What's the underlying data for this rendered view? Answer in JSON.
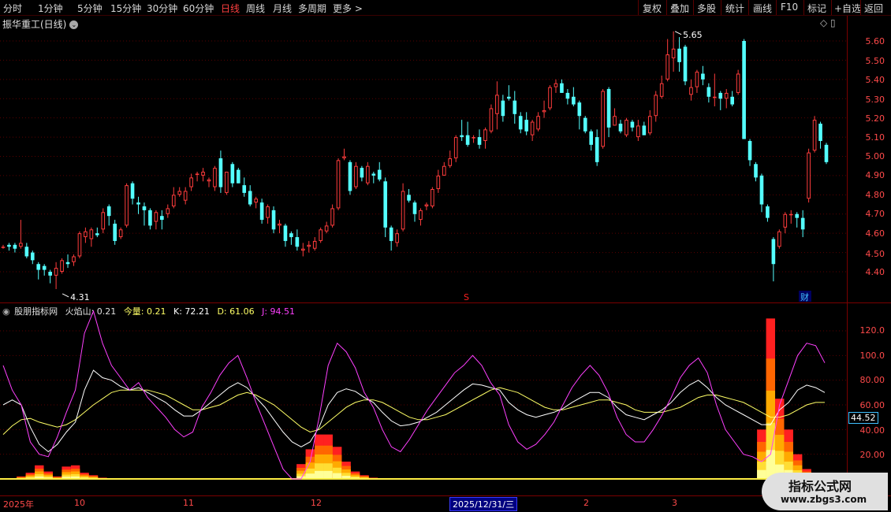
{
  "toolbar": {
    "periods": [
      "分时",
      "1分钟",
      "5分钟",
      "15分钟",
      "30分钟",
      "60分钟",
      "日线",
      "周线",
      "月线",
      "多周期",
      "更多 >"
    ],
    "active": "日线",
    "actions": [
      "复权",
      "叠加",
      "多股",
      "统计",
      "画线",
      "F10",
      "标记",
      "+自选",
      "返回"
    ]
  },
  "stock": {
    "title": "振华重工(日线)",
    "icon": "chevron-down-icon"
  },
  "top_icons": "◇ ▯",
  "price_axis": [
    "5.60",
    "5.50",
    "5.40",
    "5.30",
    "5.20",
    "5.10",
    "5.00",
    "4.90",
    "4.80",
    "4.70",
    "4.60",
    "4.50",
    "4.40"
  ],
  "price_marks": {
    "high": "5.65",
    "low": "4.31",
    "s_mark": "S",
    "cai_badge": "财"
  },
  "indicator": {
    "name": "股朋指标网",
    "huoyanshan": "火焰山: 0.21",
    "jinliang": "今量: 0.21",
    "k": "K: 72.21",
    "d": "D: 61.06",
    "j": "J: 94.51"
  },
  "ind_axis": [
    "120.0",
    "100.0",
    "80.00",
    "60.00",
    "40.00",
    "20.00"
  ],
  "cursor_value": "44.52",
  "date_axis": [
    "2025年",
    "10",
    "11",
    "12",
    "2",
    "3"
  ],
  "selected_date": "2025/12/31/三",
  "watermark": {
    "line1": "指标公式网",
    "line2": "www.zbgs3.com"
  },
  "colors": {
    "up": "#ff3c3c",
    "down": "#54ffff",
    "k_line": "#ffffff",
    "d_line": "#ffff66",
    "j_line": "#ff40ff"
  },
  "chart_data": {
    "type": "candlestick",
    "ylim": [
      4.35,
      5.65
    ],
    "candles": [
      [
        4.53,
        4.54,
        4.52,
        4.53
      ],
      [
        4.54,
        4.55,
        4.51,
        4.53
      ],
      [
        4.54,
        4.55,
        4.5,
        4.52
      ],
      [
        4.53,
        4.67,
        4.52,
        4.55
      ],
      [
        4.53,
        4.55,
        4.47,
        4.48
      ],
      [
        4.5,
        4.51,
        4.44,
        4.46
      ],
      [
        4.44,
        4.45,
        4.36,
        4.41
      ],
      [
        4.43,
        4.44,
        4.38,
        4.41
      ],
      [
        4.4,
        4.41,
        4.34,
        4.38
      ],
      [
        4.38,
        4.45,
        4.31,
        4.42
      ],
      [
        4.4,
        4.47,
        4.39,
        4.46
      ],
      [
        4.45,
        4.49,
        4.42,
        4.44
      ],
      [
        4.45,
        4.49,
        4.43,
        4.48
      ],
      [
        4.48,
        4.61,
        4.47,
        4.6
      ],
      [
        4.58,
        4.63,
        4.55,
        4.61
      ],
      [
        4.57,
        4.63,
        4.53,
        4.62
      ],
      [
        4.6,
        4.63,
        4.58,
        4.59
      ],
      [
        4.62,
        4.73,
        4.6,
        4.71
      ],
      [
        4.74,
        4.75,
        4.64,
        4.69
      ],
      [
        4.65,
        4.67,
        4.54,
        4.56
      ],
      [
        4.58,
        4.63,
        4.57,
        4.62
      ],
      [
        4.64,
        4.86,
        4.63,
        4.85
      ],
      [
        4.86,
        4.87,
        4.75,
        4.78
      ],
      [
        4.76,
        4.79,
        4.7,
        4.75
      ],
      [
        4.74,
        4.76,
        4.64,
        4.72
      ],
      [
        4.72,
        4.73,
        4.62,
        4.64
      ],
      [
        4.66,
        4.72,
        4.62,
        4.71
      ],
      [
        4.69,
        4.72,
        4.62,
        4.67
      ],
      [
        4.7,
        4.75,
        4.68,
        4.73
      ],
      [
        4.74,
        4.84,
        4.73,
        4.8
      ],
      [
        4.8,
        4.84,
        4.79,
        4.82
      ],
      [
        4.77,
        4.84,
        4.75,
        4.82
      ],
      [
        4.84,
        4.91,
        4.82,
        4.89
      ],
      [
        4.91,
        4.92,
        4.87,
        4.91
      ],
      [
        4.9,
        4.94,
        4.87,
        4.92
      ],
      [
        4.87,
        4.89,
        4.84,
        4.88
      ],
      [
        4.84,
        4.95,
        4.82,
        4.94
      ],
      [
        4.99,
        5.03,
        4.81,
        4.84
      ],
      [
        4.81,
        4.92,
        4.8,
        4.92
      ],
      [
        4.96,
        4.97,
        4.84,
        4.86
      ],
      [
        4.93,
        4.94,
        4.86,
        4.86
      ],
      [
        4.85,
        4.89,
        4.79,
        4.81
      ],
      [
        4.82,
        4.85,
        4.74,
        4.75
      ],
      [
        4.76,
        4.79,
        4.73,
        4.78
      ],
      [
        4.76,
        4.78,
        4.65,
        4.67
      ],
      [
        4.68,
        4.75,
        4.65,
        4.74
      ],
      [
        4.72,
        4.74,
        4.6,
        4.62
      ],
      [
        4.64,
        4.67,
        4.6,
        4.65
      ],
      [
        4.64,
        4.65,
        4.53,
        4.56
      ],
      [
        4.6,
        4.61,
        4.54,
        4.58
      ],
      [
        4.58,
        4.62,
        4.51,
        4.53
      ],
      [
        4.51,
        4.55,
        4.48,
        4.52
      ],
      [
        4.53,
        4.56,
        4.5,
        4.54
      ],
      [
        4.52,
        4.58,
        4.51,
        4.56
      ],
      [
        4.56,
        4.63,
        4.55,
        4.62
      ],
      [
        4.61,
        4.66,
        4.6,
        4.64
      ],
      [
        4.64,
        4.75,
        4.63,
        4.73
      ],
      [
        4.73,
        4.99,
        4.72,
        4.98
      ],
      [
        4.99,
        5.04,
        4.98,
        5.0
      ],
      [
        4.97,
        4.98,
        4.8,
        4.82
      ],
      [
        4.84,
        4.97,
        4.83,
        4.95
      ],
      [
        4.94,
        4.95,
        4.87,
        4.89
      ],
      [
        4.86,
        4.97,
        4.85,
        4.95
      ],
      [
        4.91,
        4.92,
        4.86,
        4.9
      ],
      [
        4.93,
        4.97,
        4.87,
        4.88
      ],
      [
        4.87,
        4.89,
        4.58,
        4.63
      ],
      [
        4.63,
        4.64,
        4.51,
        4.56
      ],
      [
        4.55,
        4.62,
        4.53,
        4.6
      ],
      [
        4.62,
        4.86,
        4.61,
        4.82
      ],
      [
        4.8,
        4.83,
        4.76,
        4.77
      ],
      [
        4.76,
        4.77,
        4.66,
        4.7
      ],
      [
        4.67,
        4.73,
        4.64,
        4.72
      ],
      [
        4.74,
        4.76,
        4.72,
        4.75
      ],
      [
        4.74,
        4.84,
        4.73,
        4.83
      ],
      [
        4.83,
        4.93,
        4.81,
        4.9
      ],
      [
        4.9,
        4.97,
        4.9,
        4.95
      ],
      [
        4.95,
        5.03,
        4.94,
        4.99
      ],
      [
        4.99,
        5.11,
        4.97,
        5.1
      ],
      [
        5.11,
        5.19,
        5.08,
        5.1
      ],
      [
        5.11,
        5.18,
        5.05,
        5.06
      ],
      [
        5.1,
        5.11,
        5.07,
        5.1
      ],
      [
        5.1,
        5.14,
        5.04,
        5.06
      ],
      [
        5.08,
        5.15,
        5.04,
        5.14
      ],
      [
        5.13,
        5.27,
        5.12,
        5.25
      ],
      [
        5.22,
        5.39,
        5.14,
        5.32
      ],
      [
        5.29,
        5.32,
        5.18,
        5.21
      ],
      [
        5.31,
        5.37,
        5.29,
        5.3
      ],
      [
        5.29,
        5.34,
        5.17,
        5.22
      ],
      [
        5.21,
        5.23,
        5.12,
        5.14
      ],
      [
        5.19,
        5.23,
        5.11,
        5.13
      ],
      [
        5.11,
        5.19,
        5.08,
        5.18
      ],
      [
        5.14,
        5.23,
        5.13,
        5.21
      ],
      [
        5.23,
        5.29,
        5.2,
        5.24
      ],
      [
        5.25,
        5.37,
        5.24,
        5.36
      ],
      [
        5.36,
        5.4,
        5.33,
        5.38
      ],
      [
        5.38,
        5.4,
        5.33,
        5.33
      ],
      [
        5.33,
        5.35,
        5.27,
        5.3
      ],
      [
        5.31,
        5.36,
        5.26,
        5.27
      ],
      [
        5.28,
        5.29,
        5.14,
        5.21
      ],
      [
        5.2,
        5.21,
        5.12,
        5.13
      ],
      [
        5.13,
        5.14,
        5.03,
        5.06
      ],
      [
        5.1,
        5.14,
        4.95,
        4.97
      ],
      [
        5.05,
        5.35,
        5.04,
        5.34
      ],
      [
        5.35,
        5.36,
        5.1,
        5.15
      ],
      [
        5.16,
        5.25,
        5.16,
        5.21
      ],
      [
        5.17,
        5.19,
        5.12,
        5.13
      ],
      [
        5.11,
        5.2,
        5.1,
        5.19
      ],
      [
        5.18,
        5.19,
        5.13,
        5.15
      ],
      [
        5.1,
        5.19,
        5.08,
        5.16
      ],
      [
        5.16,
        5.18,
        5.11,
        5.11
      ],
      [
        5.12,
        5.24,
        5.11,
        5.21
      ],
      [
        5.21,
        5.34,
        5.18,
        5.32
      ],
      [
        5.31,
        5.42,
        5.3,
        5.38
      ],
      [
        5.4,
        5.61,
        5.39,
        5.53
      ],
      [
        5.51,
        5.65,
        5.44,
        5.56
      ],
      [
        5.56,
        5.62,
        5.44,
        5.49
      ],
      [
        5.57,
        5.58,
        5.37,
        5.39
      ],
      [
        5.32,
        5.4,
        5.29,
        5.36
      ],
      [
        5.36,
        5.45,
        5.33,
        5.44
      ],
      [
        5.43,
        5.47,
        5.37,
        5.4
      ],
      [
        5.36,
        5.38,
        5.28,
        5.31
      ],
      [
        5.31,
        5.43,
        5.26,
        5.31
      ],
      [
        5.33,
        5.34,
        5.24,
        5.3
      ],
      [
        5.3,
        5.35,
        5.25,
        5.33
      ],
      [
        5.31,
        5.34,
        5.26,
        5.27
      ],
      [
        5.33,
        5.45,
        5.32,
        5.43
      ],
      [
        5.6,
        5.61,
        5.09,
        5.09
      ],
      [
        5.08,
        5.09,
        4.95,
        4.98
      ],
      [
        4.96,
        4.97,
        4.87,
        4.89
      ],
      [
        4.9,
        4.91,
        4.71,
        4.75
      ],
      [
        4.74,
        4.75,
        4.66,
        4.68
      ],
      [
        4.57,
        4.58,
        4.35,
        4.44
      ],
      [
        4.53,
        4.62,
        4.52,
        4.61
      ],
      [
        4.63,
        4.71,
        4.6,
        4.7
      ],
      [
        4.7,
        4.72,
        4.65,
        4.7
      ],
      [
        4.7,
        4.71,
        4.63,
        4.68
      ],
      [
        4.68,
        4.72,
        4.58,
        4.62
      ],
      [
        4.78,
        5.04,
        4.76,
        5.02
      ],
      [
        5.03,
        5.21,
        5.02,
        5.19
      ],
      [
        5.17,
        5.18,
        5.04,
        5.08
      ],
      [
        5.06,
        5.07,
        4.96,
        4.97
      ]
    ],
    "indicator_series": {
      "k": [
        60,
        64,
        60,
        42,
        28,
        22,
        28,
        38,
        46,
        72,
        88,
        82,
        80,
        75,
        72,
        74,
        70,
        66,
        62,
        56,
        51,
        51,
        56,
        62,
        68,
        74,
        78,
        74,
        66,
        58,
        48,
        38,
        30,
        26,
        30,
        42,
        60,
        70,
        73,
        71,
        66,
        62,
        54,
        47,
        43,
        44,
        46,
        50,
        54,
        60,
        66,
        72,
        77,
        76,
        74,
        72,
        62,
        56,
        52,
        50,
        52,
        54,
        57,
        62,
        66,
        70,
        70,
        66,
        58,
        52,
        50,
        48,
        52,
        56,
        62,
        70,
        76,
        80,
        74,
        66,
        60,
        56,
        52,
        48,
        44,
        44,
        56,
        62,
        72,
        76,
        74,
        70
      ],
      "d": [
        36,
        43,
        48,
        49,
        46,
        44,
        42,
        44,
        48,
        54,
        60,
        65,
        70,
        72,
        72,
        72,
        72,
        70,
        68,
        64,
        60,
        56,
        56,
        58,
        60,
        64,
        68,
        70,
        68,
        64,
        60,
        54,
        48,
        42,
        38,
        40,
        46,
        52,
        58,
        62,
        64,
        64,
        62,
        58,
        54,
        50,
        48,
        48,
        50,
        52,
        56,
        60,
        64,
        68,
        72,
        74,
        72,
        70,
        66,
        62,
        58,
        56,
        56,
        58,
        60,
        62,
        64,
        64,
        62,
        60,
        56,
        54,
        54,
        54,
        56,
        58,
        62,
        66,
        68,
        68,
        66,
        64,
        62,
        58,
        54,
        50,
        50,
        52,
        56,
        60,
        62,
        62
      ],
      "j": [
        92,
        72,
        60,
        30,
        20,
        18,
        34,
        54,
        72,
        118,
        136,
        110,
        92,
        82,
        72,
        78,
        66,
        58,
        50,
        40,
        34,
        38,
        58,
        70,
        84,
        94,
        100,
        82,
        62,
        44,
        26,
        8,
        0,
        0,
        14,
        50,
        92,
        110,
        103,
        90,
        70,
        58,
        40,
        26,
        22,
        32,
        44,
        56,
        66,
        76,
        86,
        92,
        100,
        92,
        78,
        68,
        44,
        30,
        24,
        28,
        36,
        46,
        60,
        74,
        84,
        92,
        84,
        70,
        50,
        36,
        30,
        30,
        40,
        52,
        66,
        82,
        92,
        98,
        86,
        60,
        40,
        30,
        20,
        18,
        14,
        20,
        60,
        80,
        100,
        110,
        108,
        94
      ],
      "flame": [
        0.3,
        0.5,
        2,
        5,
        11,
        6,
        2,
        10,
        11,
        5,
        3,
        1,
        0.5,
        0.3,
        0.2,
        0.2,
        0.2,
        0.1,
        0.1,
        0.1,
        0.1,
        0.1,
        0.1,
        0.1,
        0.1,
        0.1,
        0.1,
        0.1,
        0.1,
        0.1,
        0.1,
        0.1,
        0.1,
        12,
        24,
        36,
        36,
        26,
        14,
        6,
        3,
        1,
        0.5,
        0.3,
        0.2,
        0.2,
        0.2,
        0.2,
        0.2,
        0.1,
        0.1,
        0.1,
        0.1,
        0.1,
        0.1,
        0.1,
        0.1,
        0.1,
        0.1,
        0.1,
        0.1,
        0.1,
        0.1,
        0.1,
        0.1,
        0.1,
        0.1,
        0.1,
        0.1,
        0.1,
        0.1,
        0.1,
        0.1,
        0.1,
        0.1,
        0.1,
        0.1,
        0.1,
        0.1,
        0.1,
        0.1,
        0.1,
        0.1,
        0.2,
        40,
        130,
        65,
        40,
        20,
        8,
        2,
        0.21
      ],
      "ylim": [
        0,
        130
      ]
    }
  }
}
